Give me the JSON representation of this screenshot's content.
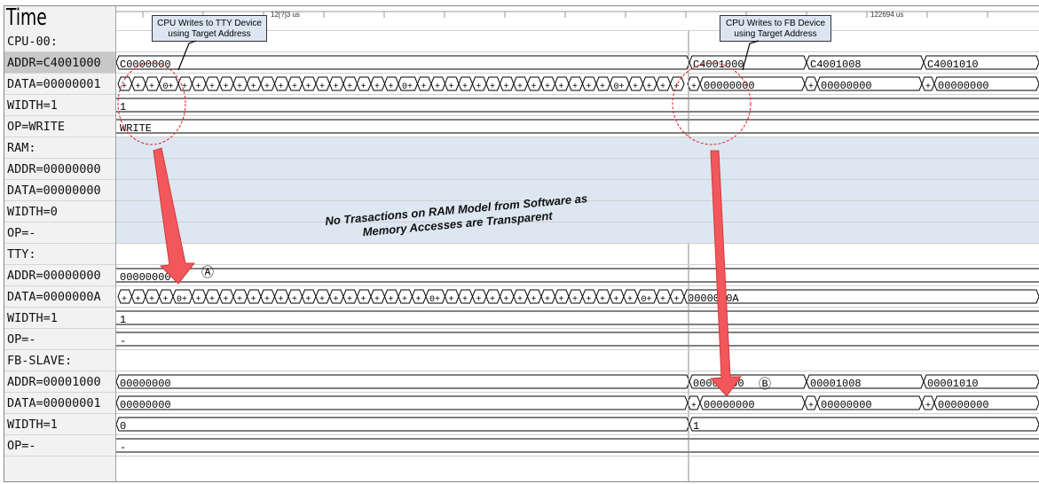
{
  "header": {
    "title": "Time"
  },
  "timeline": {
    "tick_left": "12[?]3 us",
    "tick_right": "122694 us"
  },
  "callouts": {
    "tty": "CPU Writes to TTY Device using Target Address",
    "fb": "CPU Writes to FB Device using Target Address"
  },
  "note": "No Trasactions on RAM Model from Software as Memory Accesses are Transparent",
  "markers": {
    "a": "Ⓐ",
    "b": "Ⓑ"
  },
  "signals": [
    {
      "id": "cpu",
      "name": "CPU-00:"
    },
    {
      "id": "cpu-addr",
      "name": "ADDR=C4001000"
    },
    {
      "id": "cpu-data",
      "name": "DATA=00000001"
    },
    {
      "id": "cpu-width",
      "name": "WIDTH=1"
    },
    {
      "id": "cpu-op",
      "name": "OP=WRITE"
    },
    {
      "id": "ram",
      "name": "RAM:"
    },
    {
      "id": "ram-addr",
      "name": "ADDR=00000000"
    },
    {
      "id": "ram-data",
      "name": "DATA=00000000"
    },
    {
      "id": "ram-width",
      "name": "WIDTH=0"
    },
    {
      "id": "ram-op",
      "name": "OP=-"
    },
    {
      "id": "tty",
      "name": "TTY:"
    },
    {
      "id": "tty-addr",
      "name": "ADDR=00000000"
    },
    {
      "id": "tty-data",
      "name": "DATA=0000000A"
    },
    {
      "id": "tty-width",
      "name": "WIDTH=1"
    },
    {
      "id": "tty-op",
      "name": "OP=-"
    },
    {
      "id": "fb",
      "name": "FB-SLAVE:"
    },
    {
      "id": "fb-addr",
      "name": "ADDR=00001000"
    },
    {
      "id": "fb-data",
      "name": "DATA=00000001"
    },
    {
      "id": "fb-width",
      "name": "WIDTH=1"
    },
    {
      "id": "fb-op",
      "name": "OP=-"
    }
  ],
  "values": {
    "cpu_addr": [
      "C0000000",
      "C4001000",
      "C4001008",
      "C4001010"
    ],
    "cpu_data_small": "+",
    "cpu_data_zero_plus": "0+",
    "cpu_data": [
      "00000000",
      "00000000",
      "00000000"
    ],
    "cpu_width": "1",
    "cpu_op": "WRITE",
    "ram_addr": "00000000",
    "ram_data": "00000000",
    "ram_width": "0",
    "ram_op": "-",
    "tty_addr": "00000000",
    "tty_data_tail": "0000000A",
    "tty_width": "1",
    "tty_op": "-",
    "fb_addr": [
      "00000000",
      "00001000",
      "00001008",
      "00001010"
    ],
    "fb_data": [
      "00000000",
      "00000000",
      "00000000",
      "00000000"
    ],
    "fb_width": [
      "0",
      "1"
    ],
    "fb_op": "-"
  },
  "colors": {
    "ram_band": "#dde7f2",
    "arrow": "#f2575b",
    "circle": "#e02020",
    "callout": "#dce6f2"
  }
}
